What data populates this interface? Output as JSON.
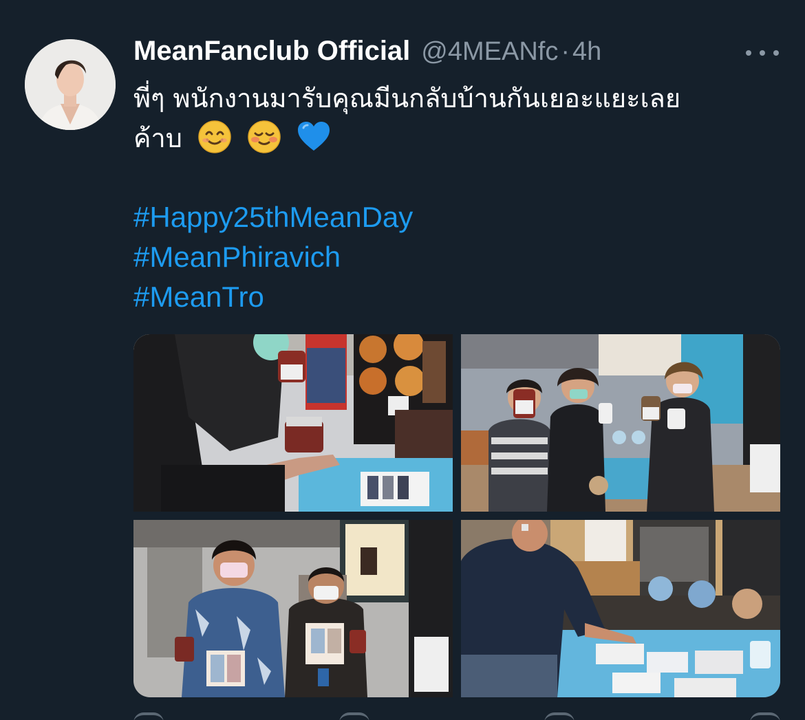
{
  "tweet": {
    "display_name": "MeanFanclub Official",
    "handle": "@4MEANfc",
    "separator": "·",
    "time": "4h",
    "text_line1": "พี่ๆ พนักงานมารับคุณมีนกลับบ้านกันเยอะแยะเลย",
    "text_line2": "ค้าบ",
    "emojis": [
      "smiling-face-icon",
      "blushing-face-icon",
      "blue-heart-icon"
    ],
    "hashtags": [
      "#Happy25thMeanDay",
      "#MeanPhiravich",
      "#MeanTro"
    ],
    "photos": 4
  },
  "colors": {
    "background": "#15202b",
    "text_primary": "#ffffff",
    "text_secondary": "#8b98a5",
    "link": "#1d9bf0"
  }
}
